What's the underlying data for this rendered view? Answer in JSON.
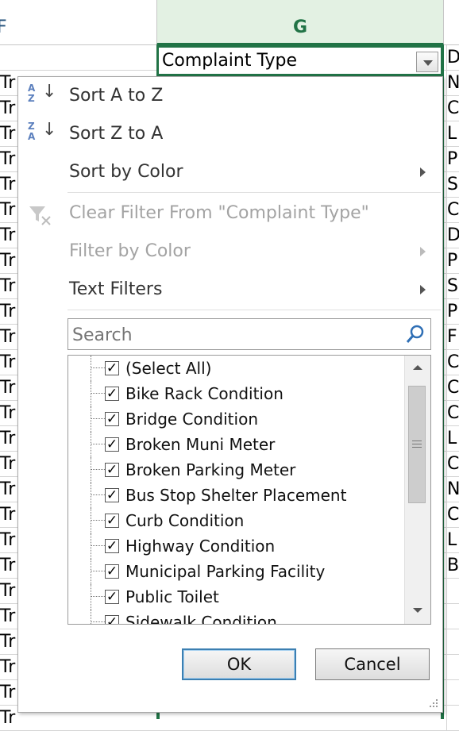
{
  "sheet": {
    "column_headers": {
      "f": "F",
      "g": "G"
    },
    "header_cell": "Complaint Type",
    "left_cells": [
      "Tr",
      "Tr",
      "Tr",
      "Tr",
      "Tr",
      "Tr",
      "Tr",
      "Tr",
      "Tr",
      "Tr",
      "Tr",
      "Tr",
      "Tr",
      "Tr",
      "Tr",
      "Tr",
      "Tr",
      "Tr",
      "Tr",
      "Tr",
      "Tr",
      "Tr",
      "Tr",
      "Tr",
      "Tr",
      "Tr"
    ],
    "right_cells": [
      "D",
      "N",
      "C",
      "L",
      "P",
      "S",
      "C",
      "D",
      "P",
      "S",
      "P",
      "F",
      "C",
      "C",
      "C",
      "L",
      "C",
      "N",
      "C",
      "L",
      "B"
    ]
  },
  "menu": {
    "sort_az": "Sort A to Z",
    "sort_za": "Sort Z to A",
    "sort_by_color": "Sort by Color",
    "clear_filter": "Clear Filter From \"Complaint Type\"",
    "filter_by_color": "Filter by Color",
    "text_filters": "Text Filters",
    "search_placeholder": "Search",
    "items": [
      "(Select All)",
      "Bike Rack Condition",
      "Bridge Condition",
      "Broken Muni Meter",
      "Broken Parking Meter",
      "Bus Stop Shelter Placement",
      "Curb Condition",
      "Highway Condition",
      "Municipal Parking Facility",
      "Public Toilet",
      "Sidewalk Condition"
    ],
    "ok_label": "OK",
    "cancel_label": "Cancel"
  }
}
